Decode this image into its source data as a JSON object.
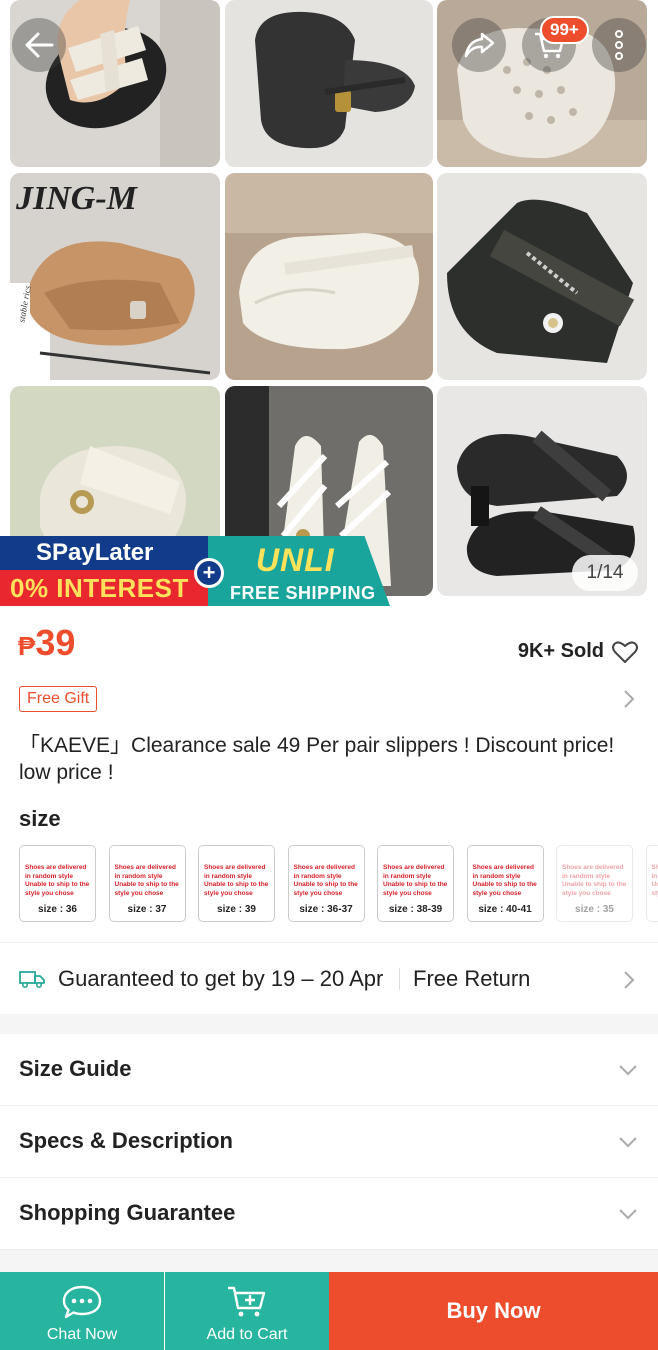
{
  "gallery": {
    "counter": "1/14",
    "cart_badge": "99+",
    "watermark": "JING-M",
    "box_text": "stable rics",
    "promo": {
      "paylater": "SPayLater",
      "interest": "0% INTEREST",
      "unli": "UNLI",
      "free_shipping": "FREE SHIPPING",
      "plus": "+"
    }
  },
  "product": {
    "currency": "₱",
    "price": "39",
    "sold": "9K+ Sold",
    "free_gift": "Free Gift",
    "title": "「KAEVE」Clearance sale 49 Per pair slippers ! Discount price! low price !",
    "size_heading": "size",
    "size_note": "Shoes are delivered in random style Unable to ship to the style you chose",
    "size_prefix": "size :",
    "sizes": [
      "36",
      "37",
      "39",
      "36-37",
      "38-39",
      "40-41",
      "35"
    ]
  },
  "shipping": {
    "guarantee": "Guaranteed to get by 19 – 20 Apr",
    "free_return": "Free Return"
  },
  "sections": {
    "size_guide": "Size Guide",
    "specs": "Specs & Description",
    "shopping_guarantee": "Shopping Guarantee"
  },
  "bottom_bar": {
    "chat": "Chat Now",
    "add_to_cart": "Add to Cart",
    "buy_now": "Buy Now"
  },
  "colors": {
    "primary": "#ee4d2d",
    "teal": "#27b5a0"
  },
  "icons": [
    "back-arrow-icon",
    "share-icon",
    "cart-icon",
    "more-icon",
    "heart-icon",
    "chevron-right-icon",
    "truck-icon",
    "chevron-down-icon",
    "chat-icon",
    "cart-add-icon"
  ]
}
